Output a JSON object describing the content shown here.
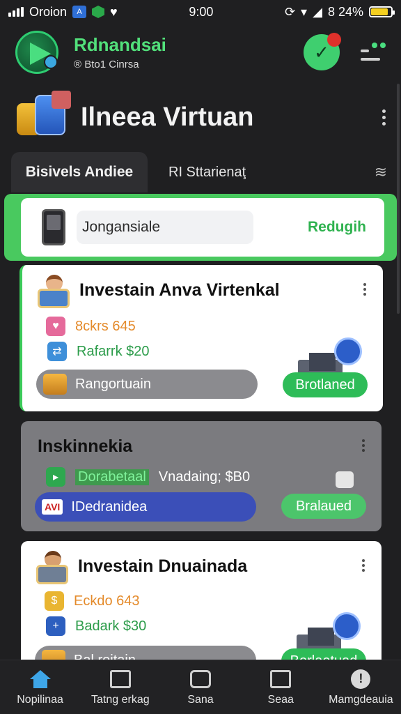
{
  "status": {
    "carrier": "Oroion",
    "time": "9:00",
    "battery": "8 24%",
    "battery_level": 0.84
  },
  "header": {
    "app_name": "Rdnandsai",
    "subtitle": "® Bto1 Cinrsa"
  },
  "page": {
    "title": "Ilneea Virtuan"
  },
  "tabs": [
    {
      "label": "Bisivels Andiee",
      "active": true
    },
    {
      "label": "RI Sttarienaţ",
      "active": false
    }
  ],
  "banner": {
    "field_label": "Jongansiale",
    "action_label": "Redugih"
  },
  "cards": [
    {
      "title": "Investain Anva Virtenkal",
      "row1": "8ckrs 645",
      "row2": "Rafarrk $20",
      "pill_label": "Rangortuain",
      "button_label": "Brotlaned"
    },
    {
      "title": "Inskinnekia",
      "row1a": "Dorabetaal",
      "row1b": "Vnadaing; $B0",
      "pill_label": "IDedranidea",
      "pill_badge": "AVI",
      "button_label": "Bralaued"
    },
    {
      "title": "Investain Dnuainada",
      "row1": "Eckdo 643",
      "row2": "Badark $30",
      "pill_label": "Bal roitain",
      "button_label": "Borlaetuad"
    }
  ],
  "nav": [
    {
      "label": "Nopilinaa",
      "icon": "home-icon"
    },
    {
      "label": "Tatng erkag",
      "icon": "chart-icon"
    },
    {
      "label": "Sana",
      "icon": "wallet-icon"
    },
    {
      "label": "Seaa",
      "icon": "swap-icon"
    },
    {
      "label": "Mamgdeauia",
      "icon": "info-icon"
    }
  ],
  "colors": {
    "accent": "#3ccb5a",
    "background": "#1f1f21",
    "alert": "#e0312b",
    "pill_blue": "#3b4fb8"
  }
}
